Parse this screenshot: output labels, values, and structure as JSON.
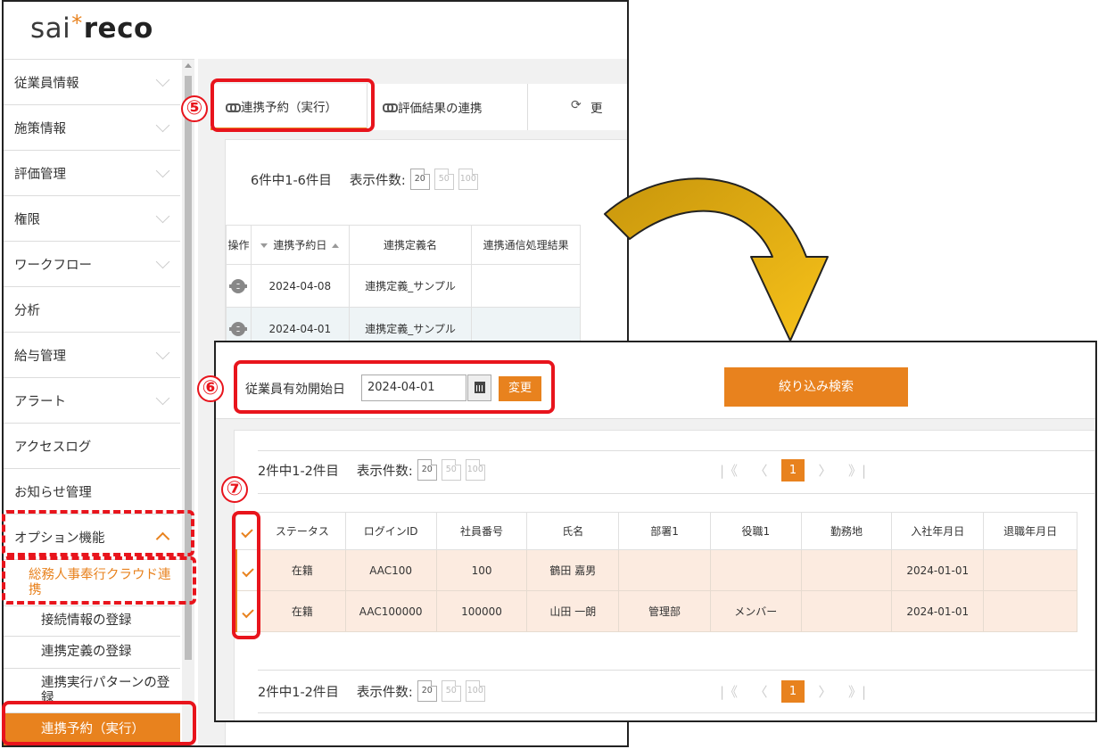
{
  "logo": {
    "left": "sai",
    "right": "reco"
  },
  "sidebar": {
    "items": [
      {
        "label": "従業員情報"
      },
      {
        "label": "施策情報"
      },
      {
        "label": "評価管理"
      },
      {
        "label": "権限"
      },
      {
        "label": "ワークフロー"
      },
      {
        "label": "分析"
      },
      {
        "label": "給与管理"
      },
      {
        "label": "アラート"
      },
      {
        "label": "アクセスログ"
      },
      {
        "label": "お知らせ管理"
      },
      {
        "label": "オプション機能"
      }
    ],
    "sub_group": "総務人事奉行クラウド連携",
    "sub_items": [
      {
        "label": "接続情報の登録"
      },
      {
        "label": "連携定義の登録"
      },
      {
        "label": "連携実行パターンの登録"
      },
      {
        "label": "連携予約（実行）"
      }
    ]
  },
  "tabs": [
    {
      "label": "連携予約（実行）"
    },
    {
      "label": "評価結果の連携"
    },
    {
      "label": "更"
    }
  ],
  "list1": {
    "count_text": "6件中1-6件目",
    "page_size_label": "表示件数:",
    "page_sizes": [
      "20",
      "50",
      "100"
    ],
    "headers": [
      "操作",
      "連携予約日",
      "連携定義名",
      "連携通信処理結果"
    ],
    "rows": [
      {
        "date": "2024-04-08",
        "name": "連携定義_サンプル",
        "result": ""
      },
      {
        "date": "2024-04-01",
        "name": "連携定義_サンプル",
        "result": ""
      }
    ]
  },
  "steps": {
    "s5": "⑤",
    "s6": "⑥",
    "s7": "⑦"
  },
  "filter": {
    "label": "従業員有効開始日",
    "date_value": "2024-04-01",
    "change_label": "変更",
    "search_label": "絞り込み検索"
  },
  "list2": {
    "count_text": "2件中1-2件目",
    "page_size_label": "表示件数:",
    "page_sizes": [
      "20",
      "50",
      "100"
    ],
    "pager": {
      "first": "|《",
      "prev": "〈",
      "current": "1",
      "next": "〉",
      "last": "》|"
    },
    "headers": [
      "ステータス",
      "ログインID",
      "社員番号",
      "氏名",
      "部署1",
      "役職1",
      "勤務地",
      "入社年月日",
      "退職年月日"
    ],
    "rows": [
      {
        "status": "在籍",
        "login": "AAC100",
        "emp_no": "100",
        "name": "鶴田 嘉男",
        "dept": "",
        "title": "",
        "office": "",
        "join": "2024-01-01",
        "leave": ""
      },
      {
        "status": "在籍",
        "login": "AAC100000",
        "emp_no": "100000",
        "name": "山田 一朗",
        "dept": "管理部",
        "title": "メンバー",
        "office": "",
        "join": "2024-01-01",
        "leave": ""
      }
    ]
  },
  "colors": {
    "accent": "#e8821e",
    "annotation": "#e8141c",
    "arrow": "#f0b020"
  }
}
